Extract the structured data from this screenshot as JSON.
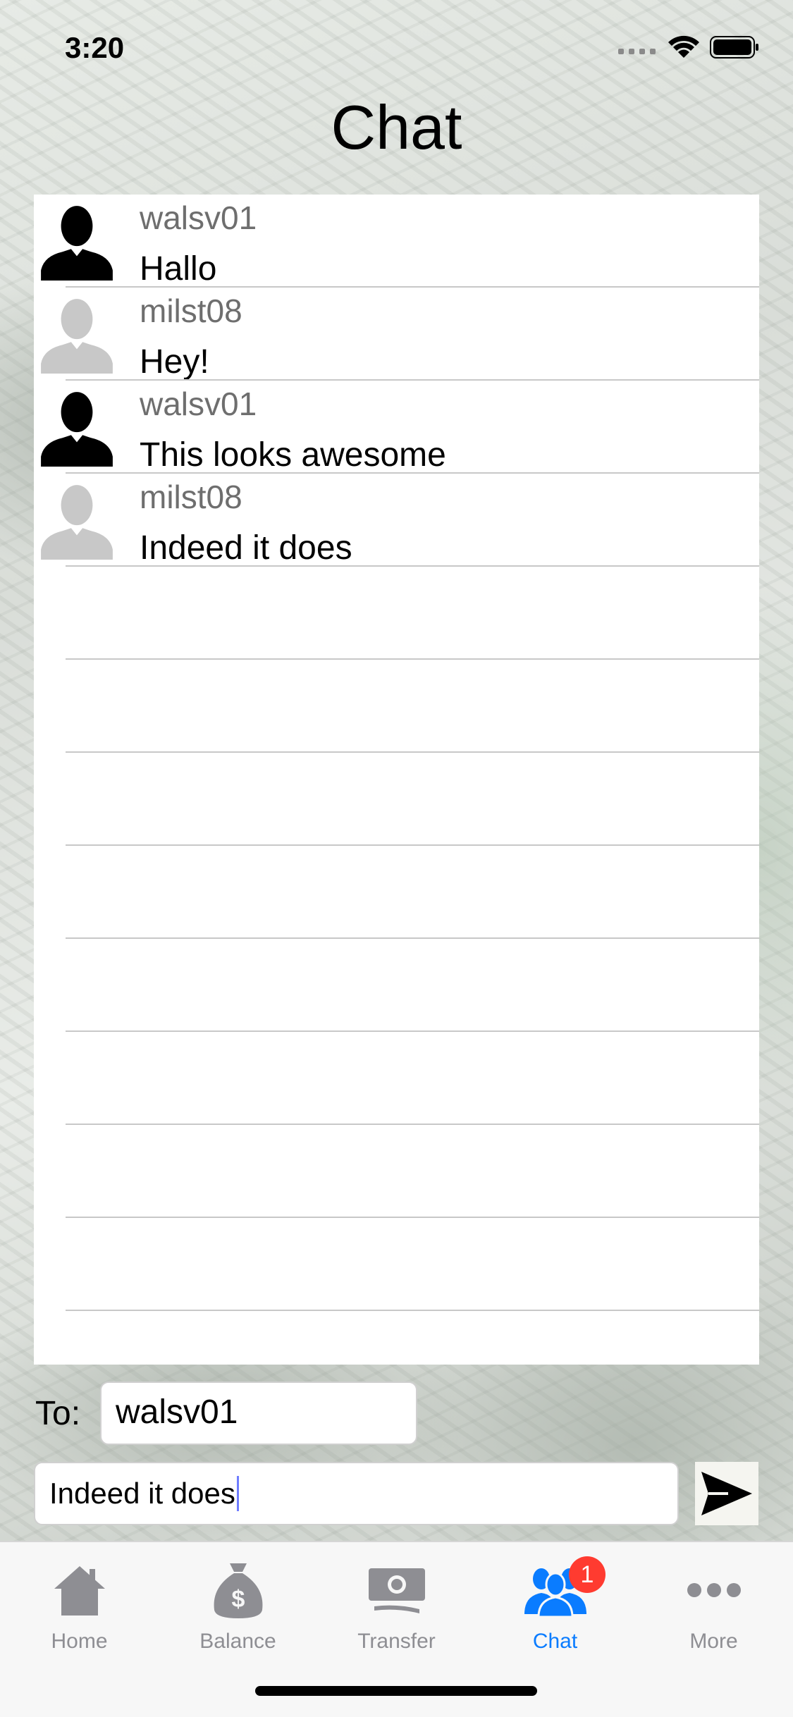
{
  "status_bar": {
    "time": "3:20"
  },
  "page": {
    "title": "Chat"
  },
  "messages": [
    {
      "sender": "walsv01",
      "text": "Hallo",
      "avatar": "dark-person-icon"
    },
    {
      "sender": "milst08",
      "text": "Hey!",
      "avatar": "light-person-icon"
    },
    {
      "sender": "walsv01",
      "text": "This looks awesome",
      "avatar": "dark-person-icon"
    },
    {
      "sender": "milst08",
      "text": "Indeed it does",
      "avatar": "light-person-icon"
    }
  ],
  "composer": {
    "to_label": "To:",
    "to_value": "walsv01",
    "message_value": "Indeed it does"
  },
  "tabs": [
    {
      "label": "Home",
      "icon": "house-icon",
      "active": false
    },
    {
      "label": "Balance",
      "icon": "money-bag-icon",
      "active": false
    },
    {
      "label": "Transfer",
      "icon": "banknote-icon",
      "active": false
    },
    {
      "label": "Chat",
      "icon": "people-icon",
      "active": true,
      "badge": "1"
    },
    {
      "label": "More",
      "icon": "more-dots-icon",
      "active": false
    }
  ],
  "colors": {
    "active_tab": "#0a7cff",
    "inactive_tab": "#8e8e93",
    "badge": "#ff3b30"
  }
}
